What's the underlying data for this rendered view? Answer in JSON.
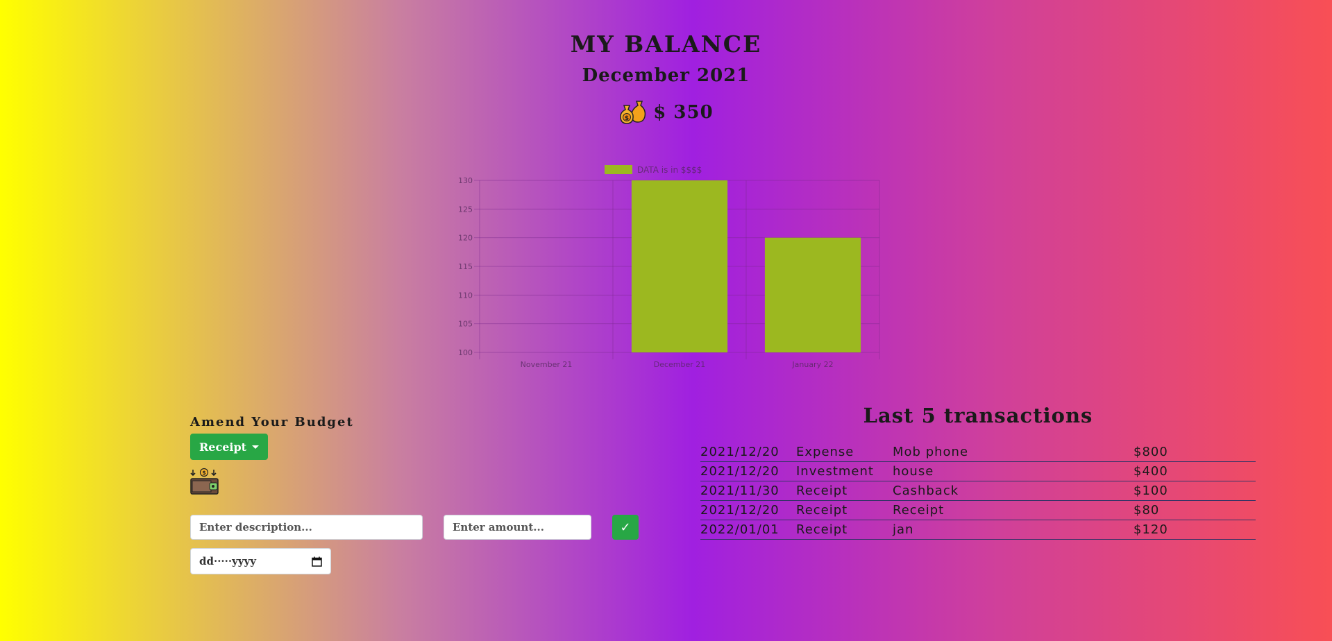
{
  "header": {
    "title": "MY BALANCE",
    "month": "December 2021",
    "balance": "$ 350",
    "balance_icon": "money-bags-icon"
  },
  "chart_data": {
    "type": "bar",
    "legend": "DATA is in $$$$",
    "categories": [
      "November 21",
      "December 21",
      "January 22"
    ],
    "values": [
      100,
      130,
      120
    ],
    "ylim": [
      100,
      130
    ],
    "yticks": [
      100,
      105,
      110,
      115,
      120,
      125,
      130
    ],
    "grid": true,
    "legend_position": "top",
    "bar_color": "#9cb820"
  },
  "amend": {
    "title": "Amend Your Budget",
    "dropdown_selected": "Receipt",
    "wallet_icon": "wallet-icon",
    "description_placeholder": "Enter description...",
    "amount_placeholder": "Enter amount...",
    "submit_label": "✓",
    "date_placeholder": "dd·····yyyy"
  },
  "transactions": {
    "title": "Last 5 transactions",
    "rows": [
      {
        "date": "2021/12/20",
        "type": "Expense",
        "description": "Mob phone",
        "amount": "$800"
      },
      {
        "date": "2021/12/20",
        "type": "Investment",
        "description": "house",
        "amount": "$400"
      },
      {
        "date": "2021/11/30",
        "type": "Receipt",
        "description": "Cashback",
        "amount": "$100"
      },
      {
        "date": "2021/12/20",
        "type": "Receipt",
        "description": "Receipt",
        "amount": "$80"
      },
      {
        "date": "2022/01/01",
        "type": "Receipt",
        "description": "jan",
        "amount": "$120"
      }
    ]
  }
}
